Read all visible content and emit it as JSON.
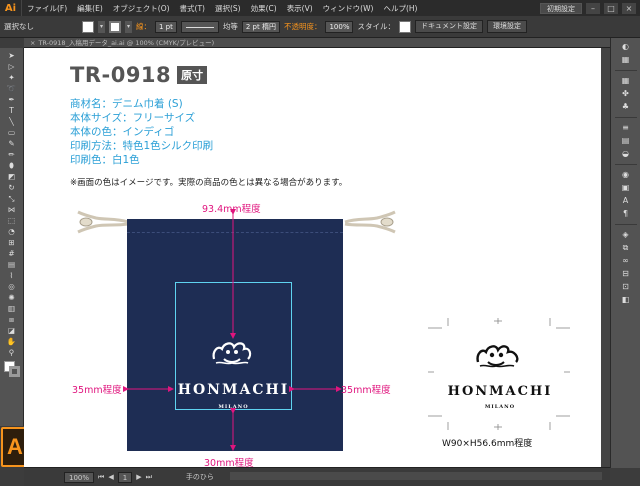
{
  "app": {
    "logo_small": "Ai",
    "logo_big": "Ai"
  },
  "menu": {
    "items": [
      "ファイル(F)",
      "編集(E)",
      "オブジェクト(O)",
      "書式(T)",
      "選択(S)",
      "効果(C)",
      "表示(V)",
      "ウィンドウ(W)",
      "ヘルプ(H)"
    ],
    "workspace": "初期設定",
    "win_controls": [
      "–",
      "□",
      "×"
    ]
  },
  "control": {
    "selection": "選択なし",
    "stroke_label": "線：",
    "stroke_weight": "1 pt",
    "profile": "均等",
    "brush": "2 pt 楕円",
    "opacity_label": "不透明度：",
    "opacity": "100%",
    "style_label": "スタイル：",
    "doc_settings": "ドキュメント設定",
    "prefs": "環境設定"
  },
  "doctab": {
    "name": "TR-0918_入稿用データ_ai.ai @ 100% (CMYK/プレビュー)"
  },
  "canvas": {
    "title_code": "TR-0918",
    "title_badge": "原寸",
    "spec": [
      "商材名：デニム巾着 (S)",
      "本体サイズ：フリーサイズ",
      "本体の色：インディゴ",
      "印刷方法：特色1色シルク印刷",
      "印刷色：白1色"
    ],
    "note": "※画面の色はイメージです。実際の商品の色とは異なる場合があります。",
    "brand": "HONMACHI",
    "sub_brand": "MILANO",
    "dims": {
      "top": "93.4mm程度",
      "left": "35mm程度",
      "right": "35mm程度",
      "bottom": "30mm程度"
    },
    "logo_dims": "W90×H56.6mm程度"
  },
  "status": {
    "zoom": "100%",
    "page": "1",
    "tool_name": "手のひら"
  },
  "colors": {
    "bag": "#1e2d54",
    "dim": "#e0157e",
    "spec": "#2a9fd6",
    "accent": "#f7941d"
  }
}
